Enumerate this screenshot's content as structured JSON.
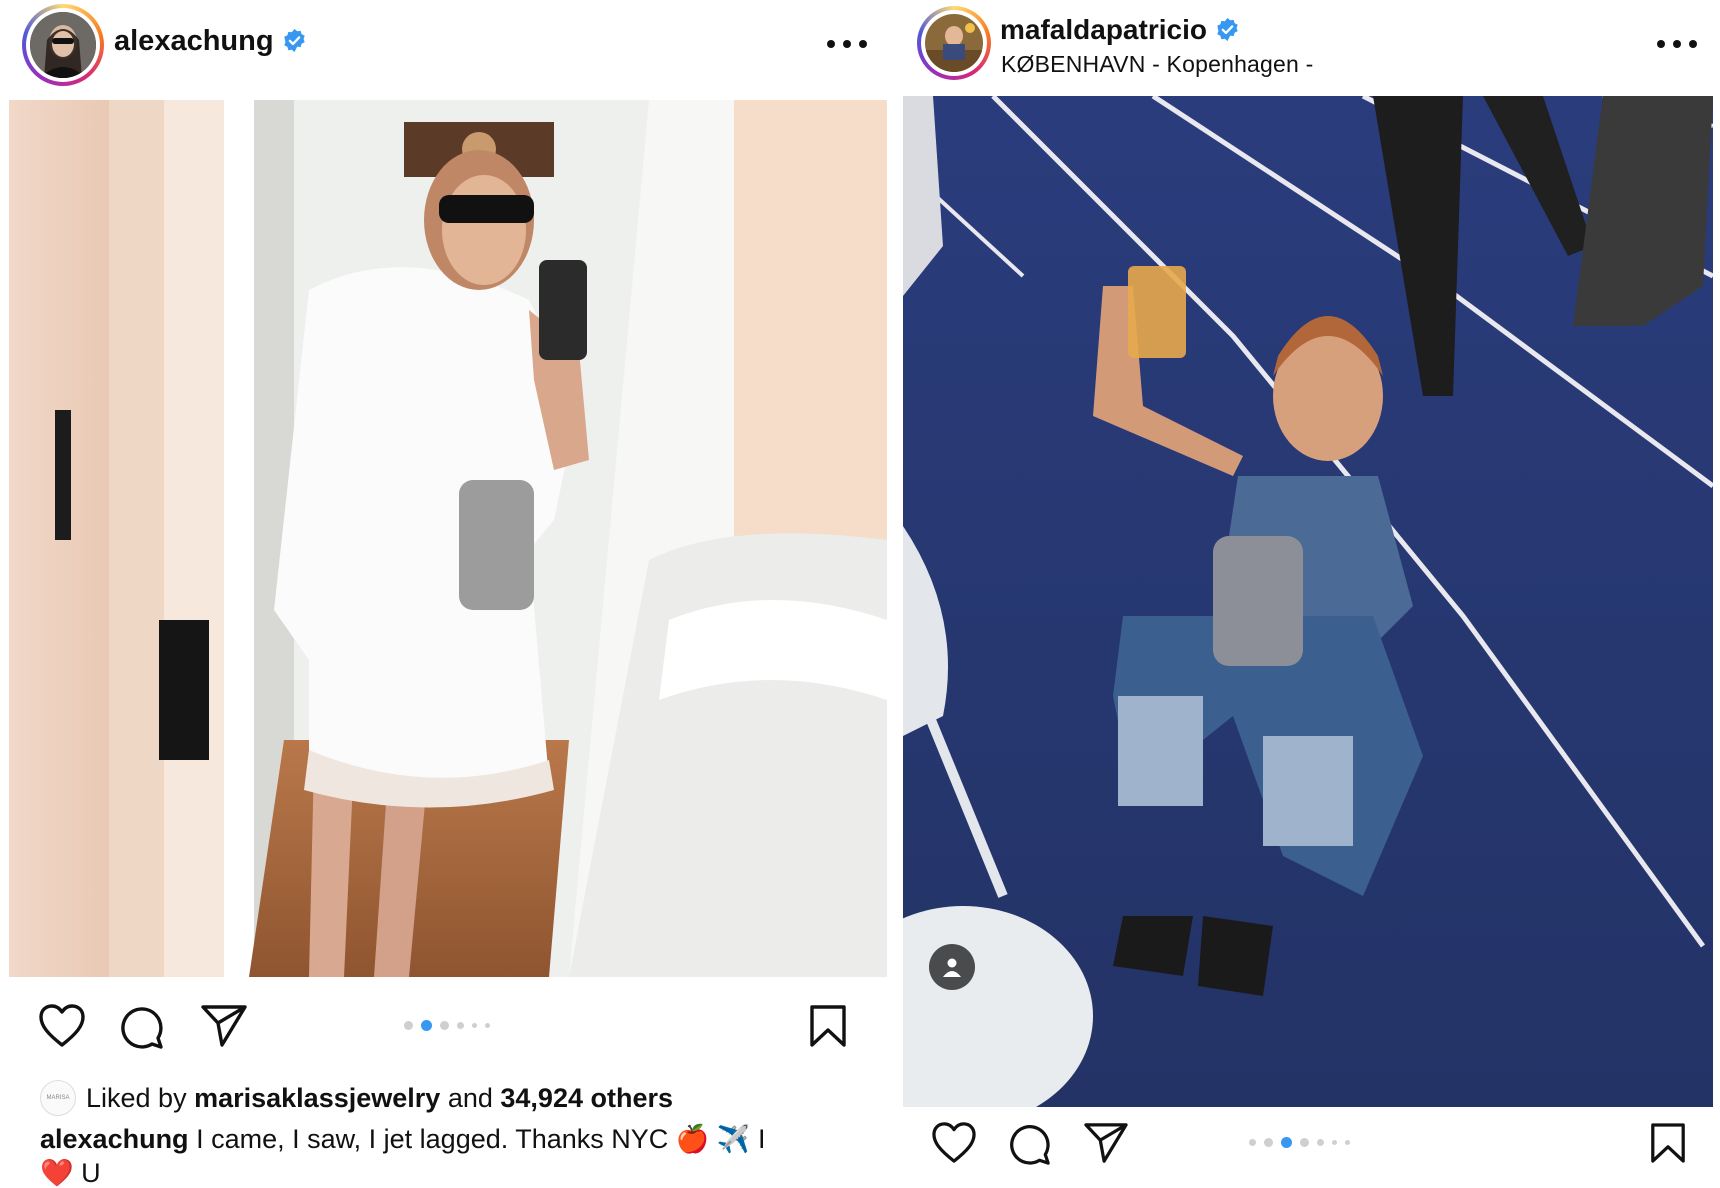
{
  "left_post": {
    "username": "alexachung",
    "verified": true,
    "more_label": "more options",
    "carousel": {
      "count": 6,
      "active_index": 1
    },
    "liked_by_prefix": "Liked by",
    "liked_by_user": "marisaklassjewelry",
    "liked_by_and": "and",
    "likes_others": "34,924 others",
    "caption_user": "alexachung",
    "caption_text": "I came, I saw, I jet lagged. Thanks NYC 🍎 ✈️ I",
    "caption_text_2": "❤️ U",
    "icons": [
      "heart-icon",
      "comment-icon",
      "share-icon",
      "bookmark-icon",
      "verified-badge-icon",
      "more-icon"
    ]
  },
  "right_post": {
    "username": "mafaldapatricio",
    "verified": true,
    "location": "KØBENHAVN - Kopenhagen -",
    "carousel": {
      "count": 7,
      "active_index": 2
    },
    "icons": [
      "heart-icon",
      "comment-icon",
      "share-icon",
      "bookmark-icon",
      "tag-people-icon",
      "verified-badge-icon",
      "more-icon"
    ]
  },
  "colors": {
    "verified_blue": "#3897f0",
    "carousel_active": "#3897f0",
    "carousel_inactive": "#cfcfcf",
    "track_blue": "#283a7a"
  }
}
